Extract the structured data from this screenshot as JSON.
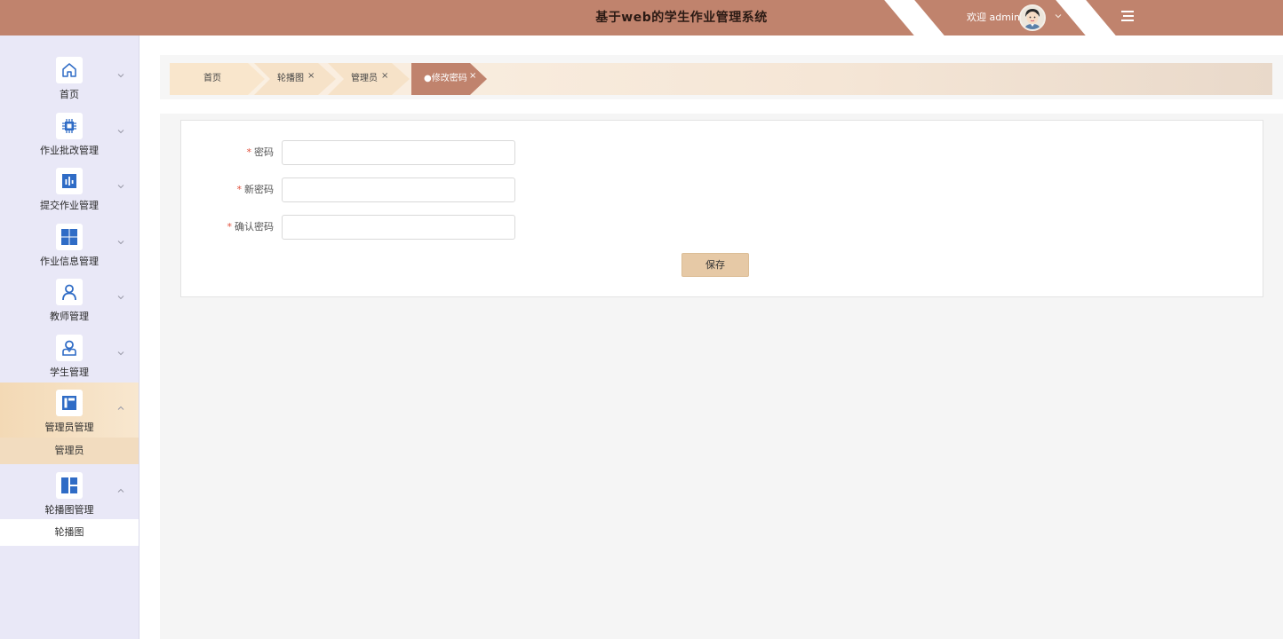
{
  "header": {
    "title": "基于web的学生作业管理系统",
    "welcome": "欢迎 admin",
    "user_menu_icon": "chevron-down-icon",
    "menu_icon": "hamburger-icon",
    "bg_color": "#c0836d"
  },
  "sidebar": {
    "items": [
      {
        "label": "首页",
        "icon": "home-icon"
      },
      {
        "label": "作业批改管理",
        "icon": "chip-icon"
      },
      {
        "label": "提交作业管理",
        "icon": "bar-chart-icon"
      },
      {
        "label": "作业信息管理",
        "icon": "grid-icon"
      },
      {
        "label": "教师管理",
        "icon": "user-icon"
      },
      {
        "label": "学生管理",
        "icon": "student-icon"
      },
      {
        "label": "管理员管理",
        "icon": "admin-icon"
      },
      {
        "label": "轮播图管理",
        "icon": "layout-icon"
      }
    ],
    "sub_items": {
      "admin": "管理员",
      "carousel": "轮播图"
    },
    "active_color": "#f3d9b5"
  },
  "tabs": [
    {
      "label": "首页",
      "closable": false
    },
    {
      "label": "轮播图",
      "closable": true
    },
    {
      "label": "管理员",
      "closable": true
    },
    {
      "label": "●修改密码",
      "closable": true,
      "active": true
    }
  ],
  "tab_close_glyph": "×",
  "form": {
    "fields": [
      {
        "label": "密码",
        "value": "",
        "required": true
      },
      {
        "label": "新密码",
        "value": "",
        "required": true
      },
      {
        "label": "确认密码",
        "value": "",
        "required": true
      }
    ],
    "required_mark": "*",
    "save_label": "保存",
    "save_color": "#e6c9a6"
  }
}
